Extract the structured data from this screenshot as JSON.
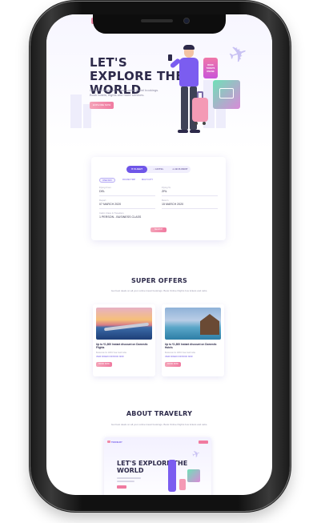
{
  "hero": {
    "title": "LET'S EXPLORE THE WORLD",
    "description": "Get best deals on all your online travel bookings. Book hotels, flights and more services.",
    "cta_label": "EXPLORE NOW",
    "ticket_text": "BOOK TICKETS ONLINE"
  },
  "booking": {
    "tabs": [
      {
        "label": "FLIGHT",
        "active": true
      },
      {
        "label": "HOTEL",
        "active": false
      },
      {
        "label": "BUS RENT",
        "active": false
      }
    ],
    "trip_types": [
      {
        "label": "ONE WAY",
        "active": true
      },
      {
        "label": "ROUND TRIP",
        "active": false
      },
      {
        "label": "MULTI CITY",
        "active": false
      }
    ],
    "fields": {
      "from_label": "Flying From",
      "from_value": "DEL",
      "to_label": "Flying To",
      "to_value": "ZRL",
      "depart_label": "Depart",
      "depart_value": "07 MARCH 2020",
      "return_label": "Return",
      "return_value": "15 MARCH 2020",
      "travellers_label": "Cabin Class & Travellers",
      "travellers_value": "1 PERSON - BUSINESS CLASS"
    },
    "search_label": "SEARCH"
  },
  "offers": {
    "title": "SUPER OFFERS",
    "subtitle": "Get best deals on all your online travel bookings. Book Online Flights bus tickets and cabs.",
    "items": [
      {
        "title": "Up to ₹1,800 Instant discount on Domestic Flights",
        "meta": "Bookcode for 100% Visa Card India",
        "link": "VIEW OFFER FOR BOOK NOW",
        "cta": "BOOK NOW"
      },
      {
        "title": "Up to ₹1,800 Instant discount on Domestic Hotels",
        "meta": "Bookcode for 100% Visa Card India",
        "link": "VIEW OFFER FOR BOOK NOW",
        "cta": "BOOK NOW"
      }
    ]
  },
  "about": {
    "title": "ABOUT TRAVELRY",
    "subtitle": "Get best deals on all your online travel bookings. Book Online Flights bus tickets and cabs.",
    "preview_logo": "TRAVELRY",
    "preview_title": "LET'S EXPLORE THE WORLD"
  }
}
